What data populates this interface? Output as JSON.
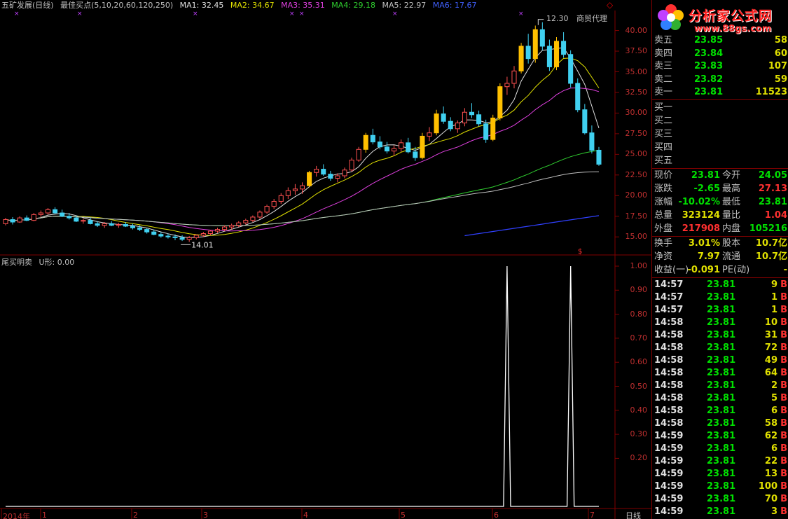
{
  "header": {
    "stock": "五矿发展(日线)",
    "indicator": "最佳买点(5,10,20,60,120,250)",
    "ma": [
      {
        "label": "MA1: 32.45",
        "color": "#e0e0e0"
      },
      {
        "label": "MA2: 34.67",
        "color": "#e0e000"
      },
      {
        "label": "MA3: 35.31",
        "color": "#e040e0"
      },
      {
        "label": "MA4: 29.18",
        "color": "#30d030"
      },
      {
        "label": "MA5: 22.97",
        "color": "#c0c0c0"
      },
      {
        "label": "MA6: 17.67",
        "color": "#4060ff"
      }
    ]
  },
  "top_right": {
    "pct": "12.30",
    "sector": "商贸代理"
  },
  "indicator_header": {
    "name": "尾买明卖",
    "value": "U形: 0.00"
  },
  "chart_data": [
    {
      "type": "candlestick",
      "title": "五矿发展(日线)",
      "ylim": [
        14,
        42
      ],
      "yticks": [
        "40.00",
        "37.50",
        "35.00",
        "32.50",
        "30.00",
        "27.50",
        "25.00",
        "22.50",
        "20.00",
        "17.50",
        "15.00"
      ],
      "annotations": [
        "14.01"
      ],
      "candles": [
        [
          16.6,
          17.3,
          16.4,
          17.1
        ],
        [
          17.1,
          17.4,
          16.5,
          16.8
        ],
        [
          16.8,
          17.5,
          16.7,
          17.3
        ],
        [
          17.3,
          17.6,
          16.9,
          17.0
        ],
        [
          17.0,
          17.9,
          16.9,
          17.7
        ],
        [
          17.7,
          18.2,
          17.4,
          17.9
        ],
        [
          17.9,
          18.5,
          17.7,
          18.3
        ],
        [
          18.3,
          18.6,
          17.8,
          17.9
        ],
        [
          17.9,
          18.3,
          17.4,
          17.5
        ],
        [
          17.5,
          17.9,
          17.1,
          17.3
        ],
        [
          17.3,
          17.6,
          16.8,
          16.9
        ],
        [
          16.9,
          17.2,
          16.6,
          17.0
        ],
        [
          17.0,
          17.3,
          16.5,
          16.6
        ],
        [
          16.6,
          16.9,
          16.2,
          16.4
        ],
        [
          16.4,
          16.8,
          16.1,
          16.6
        ],
        [
          16.6,
          16.9,
          16.3,
          16.4
        ],
        [
          16.4,
          16.7,
          16.1,
          16.5
        ],
        [
          16.5,
          16.8,
          16.2,
          16.3
        ],
        [
          16.3,
          16.6,
          15.9,
          16.1
        ],
        [
          16.1,
          16.4,
          15.7,
          15.9
        ],
        [
          15.9,
          16.1,
          15.4,
          15.6
        ],
        [
          15.6,
          15.9,
          15.2,
          15.3
        ],
        [
          15.3,
          15.6,
          14.9,
          15.1
        ],
        [
          15.1,
          15.4,
          14.8,
          15.0
        ],
        [
          15.0,
          15.3,
          14.6,
          14.9
        ],
        [
          14.9,
          15.2,
          14.5,
          14.7
        ],
        [
          14.7,
          15.1,
          14.4,
          14.9
        ],
        [
          14.9,
          15.3,
          14.7,
          15.2
        ],
        [
          15.2,
          15.6,
          15.0,
          15.4
        ],
        [
          15.4,
          15.8,
          15.2,
          15.7
        ],
        [
          15.7,
          16.1,
          15.5,
          15.9
        ],
        [
          15.9,
          16.4,
          15.7,
          16.2
        ],
        [
          16.2,
          16.6,
          15.9,
          16.4
        ],
        [
          16.4,
          16.9,
          16.2,
          16.7
        ],
        [
          16.7,
          17.2,
          16.5,
          17.0
        ],
        [
          17.0,
          17.6,
          16.8,
          17.4
        ],
        [
          17.4,
          18.2,
          17.2,
          18.0
        ],
        [
          18.0,
          18.9,
          17.8,
          18.7
        ],
        [
          18.7,
          19.6,
          18.4,
          19.3
        ],
        [
          19.3,
          20.3,
          19.0,
          20.0
        ],
        [
          20.0,
          21.0,
          19.6,
          20.6
        ],
        [
          20.6,
          21.4,
          20.1,
          20.8
        ],
        [
          20.8,
          21.6,
          20.2,
          21.2
        ],
        [
          21.2,
          23.0,
          21.0,
          22.8
        ],
        [
          22.8,
          23.6,
          22.3,
          23.2
        ],
        [
          23.2,
          23.8,
          22.4,
          22.6
        ],
        [
          22.6,
          23.0,
          21.8,
          22.1
        ],
        [
          22.1,
          22.7,
          21.6,
          22.4
        ],
        [
          22.4,
          23.4,
          22.1,
          23.1
        ],
        [
          23.1,
          24.6,
          22.9,
          24.3
        ],
        [
          24.3,
          25.9,
          24.1,
          25.6
        ],
        [
          25.6,
          27.6,
          25.2,
          27.3
        ],
        [
          27.3,
          28.1,
          26.2,
          26.5
        ],
        [
          26.5,
          27.2,
          25.6,
          25.9
        ],
        [
          25.9,
          26.5,
          25.1,
          25.4
        ],
        [
          25.4,
          26.1,
          24.8,
          25.7
        ],
        [
          25.7,
          26.8,
          25.3,
          26.4
        ],
        [
          26.4,
          27.0,
          25.1,
          25.3
        ],
        [
          25.3,
          25.9,
          24.2,
          24.6
        ],
        [
          24.6,
          27.6,
          24.4,
          27.2
        ],
        [
          27.2,
          28.3,
          26.6,
          27.6
        ],
        [
          27.6,
          30.4,
          27.3,
          29.9
        ],
        [
          29.9,
          30.8,
          28.7,
          29.0
        ],
        [
          29.0,
          29.5,
          27.8,
          28.1
        ],
        [
          28.1,
          29.1,
          27.6,
          28.8
        ],
        [
          28.8,
          30.6,
          28.4,
          30.1
        ],
        [
          30.1,
          31.2,
          29.4,
          29.8
        ],
        [
          29.8,
          30.3,
          28.4,
          28.7
        ],
        [
          28.7,
          29.2,
          26.4,
          26.8
        ],
        [
          26.8,
          29.8,
          26.6,
          29.4
        ],
        [
          29.4,
          33.6,
          29.1,
          33.2
        ],
        [
          33.2,
          34.4,
          32.2,
          33.6
        ],
        [
          33.6,
          35.7,
          33.0,
          35.1
        ],
        [
          35.1,
          38.5,
          34.8,
          38.1
        ],
        [
          38.1,
          39.6,
          36.0,
          36.6
        ],
        [
          36.6,
          40.6,
          36.1,
          40.1
        ],
        [
          40.1,
          41.0,
          37.6,
          38.1
        ],
        [
          38.1,
          38.9,
          35.1,
          35.6
        ],
        [
          35.6,
          39.2,
          35.2,
          38.7
        ],
        [
          38.7,
          39.8,
          36.7,
          37.1
        ],
        [
          37.1,
          37.6,
          33.1,
          33.6
        ],
        [
          33.6,
          34.2,
          30.1,
          30.4
        ],
        [
          30.4,
          31.1,
          27.4,
          27.6
        ],
        [
          27.6,
          28.5,
          25.1,
          25.5
        ],
        [
          25.5,
          25.9,
          23.6,
          23.8
        ]
      ]
    },
    {
      "type": "line",
      "title": "尾买明卖",
      "ylim": [
        0,
        1
      ],
      "yticks": [
        "1.00",
        "0.90",
        "0.80",
        "0.70",
        "0.60",
        "0.50",
        "0.40",
        "0.30",
        "0.20"
      ],
      "series": [
        {
          "name": "U形",
          "values": [
            0,
            0,
            0,
            0,
            0,
            0,
            0,
            0,
            0,
            0,
            0,
            0,
            0,
            0,
            0,
            0,
            0,
            0,
            0,
            0,
            0,
            0,
            0,
            0,
            0,
            0,
            0,
            0,
            0,
            0,
            0,
            0,
            0,
            0,
            0,
            0,
            0,
            0,
            0,
            0,
            0,
            0,
            0,
            0,
            0,
            0,
            0,
            0,
            0,
            0,
            0,
            0,
            0,
            0,
            0,
            0,
            0,
            0,
            0,
            0,
            0,
            0,
            0,
            0,
            0,
            0,
            0,
            0,
            0,
            0,
            0,
            1,
            0,
            0,
            0,
            0,
            0,
            0,
            0,
            0,
            1,
            0,
            0,
            0,
            0
          ]
        }
      ]
    }
  ],
  "x_labels": [
    "2014年",
    "1",
    "2",
    "3",
    "4",
    "5",
    "6",
    "7"
  ],
  "period": "日线",
  "panel": {
    "logo_text": "分析家公式网",
    "logo_url": "www.88gs.com",
    "asks": [
      {
        "label": "卖五",
        "price": "23.85",
        "vol": "58"
      },
      {
        "label": "卖四",
        "price": "23.84",
        "vol": "60"
      },
      {
        "label": "卖三",
        "price": "23.83",
        "vol": "107"
      },
      {
        "label": "卖二",
        "price": "23.82",
        "vol": "59"
      },
      {
        "label": "卖一",
        "price": "23.81",
        "vol": "11523"
      }
    ],
    "bids": [
      {
        "label": "买一",
        "price": "",
        "vol": ""
      },
      {
        "label": "买二",
        "price": "",
        "vol": ""
      },
      {
        "label": "买三",
        "price": "",
        "vol": ""
      },
      {
        "label": "买四",
        "price": "",
        "vol": ""
      },
      {
        "label": "买五",
        "price": "",
        "vol": ""
      }
    ],
    "stats": [
      {
        "l1": "现价",
        "v1": "23.81",
        "c1": "#00e000",
        "l2": "今开",
        "v2": "24.05",
        "c2": "#00e000"
      },
      {
        "l1": "涨跌",
        "v1": "-2.65",
        "c1": "#00e000",
        "l2": "最高",
        "v2": "27.13",
        "c2": "#ff3030"
      },
      {
        "l1": "涨幅",
        "v1": "-10.02%",
        "c1": "#00e000",
        "l2": "最低",
        "v2": "23.81",
        "c2": "#00e000"
      },
      {
        "l1": "总量",
        "v1": "323124",
        "c1": "#e0e000",
        "l2": "量比",
        "v2": "1.04",
        "c2": "#ff3030"
      },
      {
        "l1": "外盘",
        "v1": "217908",
        "c1": "#ff3030",
        "l2": "内盘",
        "v2": "105216",
        "c2": "#00e000"
      }
    ],
    "stats2": [
      {
        "l1": "换手",
        "v1": "3.01%",
        "c1": "#e0e000",
        "l2": "股本",
        "v2": "10.7亿",
        "c2": "#e0e000"
      },
      {
        "l1": "净资",
        "v1": "7.97",
        "c1": "#e0e000",
        "l2": "流通",
        "v2": "10.7亿",
        "c2": "#e0e000"
      },
      {
        "l1": "收益(一)",
        "v1": "-0.091",
        "c1": "#e0e000",
        "l2": "PE(动)",
        "v2": "-",
        "c2": "#e0e000"
      }
    ],
    "ticks": [
      {
        "t": "14:57",
        "p": "23.81",
        "v": "9",
        "s": "B"
      },
      {
        "t": "14:57",
        "p": "23.81",
        "v": "1",
        "s": "B"
      },
      {
        "t": "14:57",
        "p": "23.81",
        "v": "1",
        "s": "B"
      },
      {
        "t": "14:58",
        "p": "23.81",
        "v": "10",
        "s": "B"
      },
      {
        "t": "14:58",
        "p": "23.81",
        "v": "31",
        "s": "B"
      },
      {
        "t": "14:58",
        "p": "23.81",
        "v": "72",
        "s": "B"
      },
      {
        "t": "14:58",
        "p": "23.81",
        "v": "49",
        "s": "B"
      },
      {
        "t": "14:58",
        "p": "23.81",
        "v": "64",
        "s": "B"
      },
      {
        "t": "14:58",
        "p": "23.81",
        "v": "2",
        "s": "B"
      },
      {
        "t": "14:58",
        "p": "23.81",
        "v": "5",
        "s": "B"
      },
      {
        "t": "14:58",
        "p": "23.81",
        "v": "6",
        "s": "B"
      },
      {
        "t": "14:58",
        "p": "23.81",
        "v": "58",
        "s": "B"
      },
      {
        "t": "14:59",
        "p": "23.81",
        "v": "62",
        "s": "B"
      },
      {
        "t": "14:59",
        "p": "23.81",
        "v": "6",
        "s": "B"
      },
      {
        "t": "14:59",
        "p": "23.81",
        "v": "22",
        "s": "B"
      },
      {
        "t": "14:59",
        "p": "23.81",
        "v": "13",
        "s": "B"
      },
      {
        "t": "14:59",
        "p": "23.81",
        "v": "100",
        "s": "B"
      },
      {
        "t": "14:59",
        "p": "23.81",
        "v": "70",
        "s": "B"
      },
      {
        "t": "14:59",
        "p": "23.81",
        "v": "3",
        "s": "B"
      }
    ]
  }
}
